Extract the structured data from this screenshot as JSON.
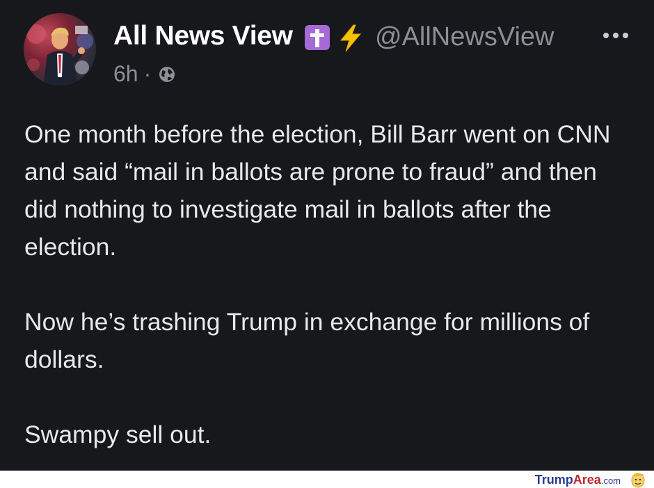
{
  "post": {
    "author": {
      "display_name": "All News View",
      "handle": "@AllNewsView",
      "badges": [
        "latin-cross-icon",
        "lightning-bolt-icon"
      ],
      "avatar": "profile-photo"
    },
    "timestamp": "6h",
    "separator": "·",
    "visibility_icon": "globe-icon",
    "more_icon": "more-dots-icon",
    "paragraphs": [
      "One month before the election, Bill Barr went on CNN and said “mail in ballots are prone to fraud” and then did nothing to investigate mail in ballots after the election.",
      "Now he’s trashing Trump in exchange for millions of dollars.",
      "Swampy sell out."
    ]
  },
  "watermark": {
    "part1": "Trump",
    "part2": "Area",
    "part3": ".com",
    "colors": {
      "primary": "#2a3c8f",
      "accent": "#c0262d"
    }
  },
  "theme": {
    "background": "#17181c",
    "text": "#e7e9ea",
    "muted": "#8c8f96",
    "badge_purple": "#a56ad6",
    "bolt_yellow": "#f5c400"
  }
}
